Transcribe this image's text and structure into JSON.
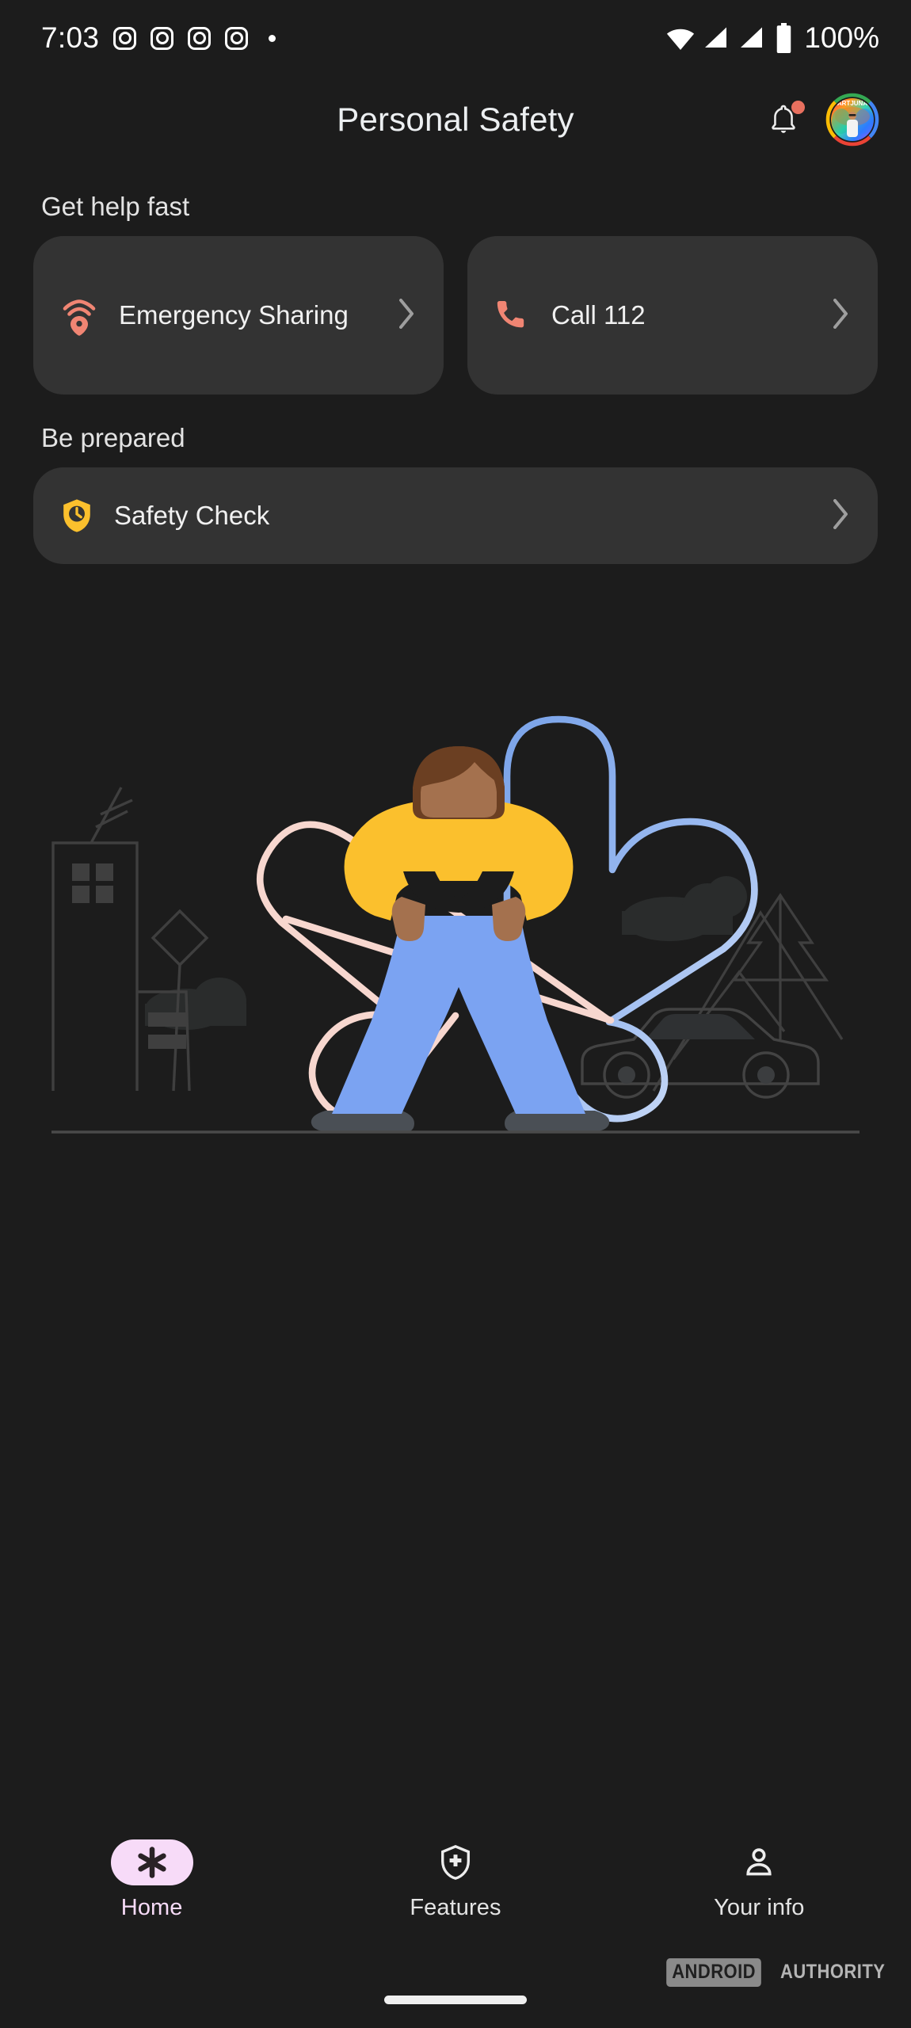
{
  "status_bar": {
    "time": "7:03",
    "notification_icons": [
      "instagram-icon",
      "instagram-icon",
      "instagram-icon",
      "instagram-icon",
      "overflow-dot"
    ],
    "wifi_icon": "wifi-icon",
    "signal_icons": [
      "cellular-signal-icon",
      "cellular-signal-icon"
    ],
    "battery_icon": "battery-full-icon",
    "battery_text": "100%"
  },
  "app_bar": {
    "title": "Personal Safety",
    "notifications_icon": "bell-icon",
    "notifications_badge": true,
    "avatar": {
      "name": "avatar",
      "ring_colors": [
        "#4285f4",
        "#ea4335",
        "#fbbc04",
        "#34a853"
      ],
      "label": "ARTJUNA"
    }
  },
  "sections": [
    {
      "title": "Get help fast",
      "cards": [
        {
          "label": "Emergency Sharing",
          "icon": "emergency-sharing-icon",
          "icon_color": "#f08573",
          "chevron": "chevron-right-icon"
        },
        {
          "label": "Call 112",
          "icon": "phone-icon",
          "icon_color": "#f08573",
          "chevron": "chevron-right-icon"
        }
      ]
    },
    {
      "title": "Be prepared",
      "cards": [
        {
          "label": "Safety Check",
          "icon": "shield-clock-icon",
          "icon_color": "#fbc02d",
          "chevron": "chevron-right-icon"
        }
      ]
    }
  ],
  "illustration": {
    "name": "person-safety-illustration",
    "alt": "Person in yellow sweater and blue jeans standing in front of a pink and blue flower outline, with city, mountains, trees and car outlines in the background",
    "colors": {
      "sweater": "#fbc02d",
      "jeans": "#7ba3f2",
      "skin": "#a4714e",
      "hair": "#6b3f22",
      "shoes": "#4a4f55",
      "petal_pink": "#f7d7cf",
      "petal_blue": "#7ea6ea",
      "background_outline": "#3d3d3d",
      "ground_line": "#4a4a4a"
    }
  },
  "bottom_nav": {
    "items": [
      {
        "label": "Home",
        "icon": "asterisk-safety-icon",
        "active": true
      },
      {
        "label": "Features",
        "icon": "shield-plus-icon",
        "active": false
      },
      {
        "label": "Your info",
        "icon": "person-icon",
        "active": false
      }
    ],
    "active_pill_color": "#f7dbf8"
  },
  "watermark": {
    "box_text": "ANDROID",
    "text": "AUTHORITY"
  },
  "theme": {
    "page_bg": "#1c1c1c",
    "card_bg": "#333333",
    "text_primary": "#f1f1f1",
    "accent_coral": "#f08573",
    "accent_yellow": "#fbc02d",
    "accent_pink": "#f7dbf8"
  }
}
